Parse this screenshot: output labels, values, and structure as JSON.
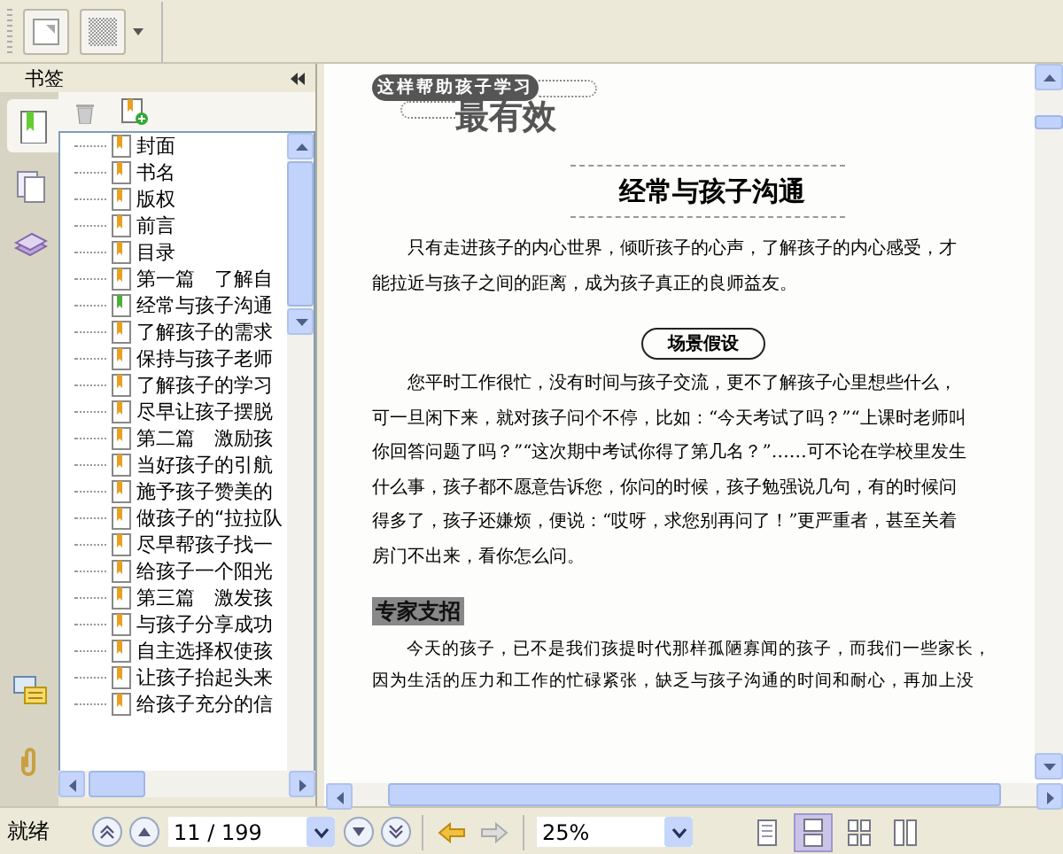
{
  "sidebar": {
    "title": "书签",
    "tabs": [
      {
        "kind": "bookmarks",
        "selected": true
      },
      {
        "kind": "pages",
        "selected": false
      },
      {
        "kind": "layers",
        "selected": false
      }
    ],
    "bottom_tabs": [
      {
        "kind": "comments"
      },
      {
        "kind": "attachments"
      }
    ],
    "bookmarks": [
      {
        "label": "封面",
        "current": false
      },
      {
        "label": "书名",
        "current": false
      },
      {
        "label": "版权",
        "current": false
      },
      {
        "label": "前言",
        "current": false
      },
      {
        "label": "目录",
        "current": false
      },
      {
        "label": "第一篇　了解自",
        "current": false
      },
      {
        "label": "经常与孩子沟通",
        "current": true
      },
      {
        "label": "了解孩子的需求",
        "current": false
      },
      {
        "label": "保持与孩子老师",
        "current": false
      },
      {
        "label": "了解孩子的学习",
        "current": false
      },
      {
        "label": "尽早让孩子摆脱",
        "current": false
      },
      {
        "label": "第二篇　激励孩",
        "current": false
      },
      {
        "label": "当好孩子的引航",
        "current": false
      },
      {
        "label": "施予孩子赞美的",
        "current": false
      },
      {
        "label": "做孩子的“拉拉队",
        "current": false
      },
      {
        "label": "尽早帮孩子找一",
        "current": false
      },
      {
        "label": "给孩子一个阳光",
        "current": false
      },
      {
        "label": "第三篇　激发孩",
        "current": false
      },
      {
        "label": "与孩子分享成功",
        "current": false
      },
      {
        "label": "自主选择权使孩",
        "current": false
      },
      {
        "label": "让孩子抬起头来",
        "current": false
      },
      {
        "label": "给孩子充分的信",
        "current": false
      }
    ]
  },
  "document": {
    "series_title": "这样帮助孩子学习",
    "series_subtitle": "最有效",
    "heading": "经常与孩子沟通",
    "intro": "只有走进孩子的内心世界，倾听孩子的心声，了解孩子的内心感受，才能拉近与孩子之间的距离，成为孩子真正的良师益友。",
    "scene_label": "场景假设",
    "scene_text": "您平时工作很忙，没有时间与孩子交流，更不了解孩子心里想些什么，可一旦闲下来，就对孩子问个不停，比如：“今天考试了吗？”“上课时老师叫你回答问题了吗？”“这次期中考试你得了第几名？”……可不论在学校里发生什么事，孩子都不愿意告诉您，你问的时候，孩子勉强说几句，有的时候问得多了，孩子还嫌烦，便说：“哎呀，求您别再问了！”更严重者，甚至关着房门不出来，看你怎么问。",
    "tip_label": "专家支招",
    "tip_text": "今天的孩子，已不是我们孩提时代那样孤陋寡闻的孩子，而我们一些家长，因为生活的压力和工作的忙碌紧张，缺乏与孩子沟通的时间和耐心，再加上没"
  },
  "status_bar": {
    "text": "就绪",
    "page": "11 / 199",
    "zoom": "25%",
    "view_modes": [
      {
        "kind": "single",
        "selected": false
      },
      {
        "kind": "continuous",
        "selected": true
      },
      {
        "kind": "facing",
        "selected": false
      },
      {
        "kind": "continuous-facing",
        "selected": false
      }
    ]
  }
}
